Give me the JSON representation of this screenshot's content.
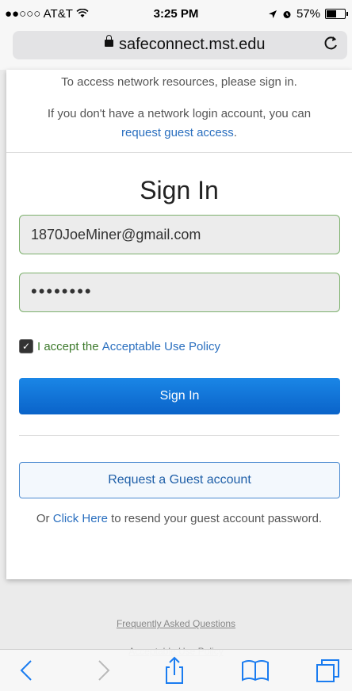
{
  "status_bar": {
    "carrier": "●●○○○ AT&T",
    "time": "3:25 PM",
    "battery": "57%",
    "battery_level": 0.57
  },
  "browser": {
    "url": "safeconnect.mst.edu"
  },
  "notice": {
    "line1": "To access network resources, please sign in.",
    "line2": "If you don't have a network login account, you can",
    "guest_link": "request guest access",
    "period": "."
  },
  "form": {
    "title": "Sign In",
    "email_value": "1870JoeMiner@gmail.com",
    "password_value": "••••••••",
    "accept_prefix": "I accept the",
    "policy_link": "Acceptable Use Policy",
    "sign_in_button": "Sign In",
    "guest_button": "Request a Guest account",
    "resend_prefix": "Or",
    "resend_link": "Click Here",
    "resend_suffix": "to resend your guest account password."
  },
  "footer": {
    "faq": "Frequently Asked Questions",
    "policy": "Acceptable Use Policy"
  },
  "colors": {
    "link": "#2a6fbf",
    "primary": "#0a6fd6",
    "field_border": "#7cb06c"
  },
  "toolbar_icons": [
    "back-icon",
    "forward-icon",
    "share-icon",
    "bookmarks-icon",
    "tabs-icon"
  ]
}
